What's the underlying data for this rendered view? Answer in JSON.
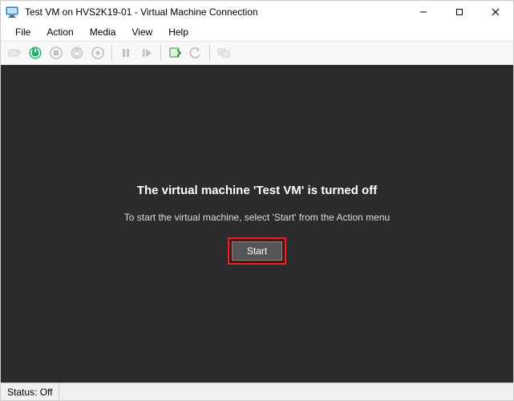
{
  "titlebar": {
    "title": "Test VM on HVS2K19-01 - Virtual Machine Connection"
  },
  "menubar": {
    "items": [
      "File",
      "Action",
      "Media",
      "View",
      "Help"
    ]
  },
  "toolbar": {
    "icons": [
      "ctrl-alt-del-icon",
      "start-icon",
      "turn-off-icon",
      "shutdown-icon",
      "save-icon",
      "pause-icon",
      "reset-icon",
      "checkpoint-icon",
      "revert-icon",
      "enhanced-session-icon"
    ]
  },
  "content": {
    "heading": "The virtual machine 'Test VM' is turned off",
    "sub": "To start the virtual machine, select 'Start' from the Action menu",
    "start_label": "Start"
  },
  "status": {
    "label": "Status: Off"
  }
}
